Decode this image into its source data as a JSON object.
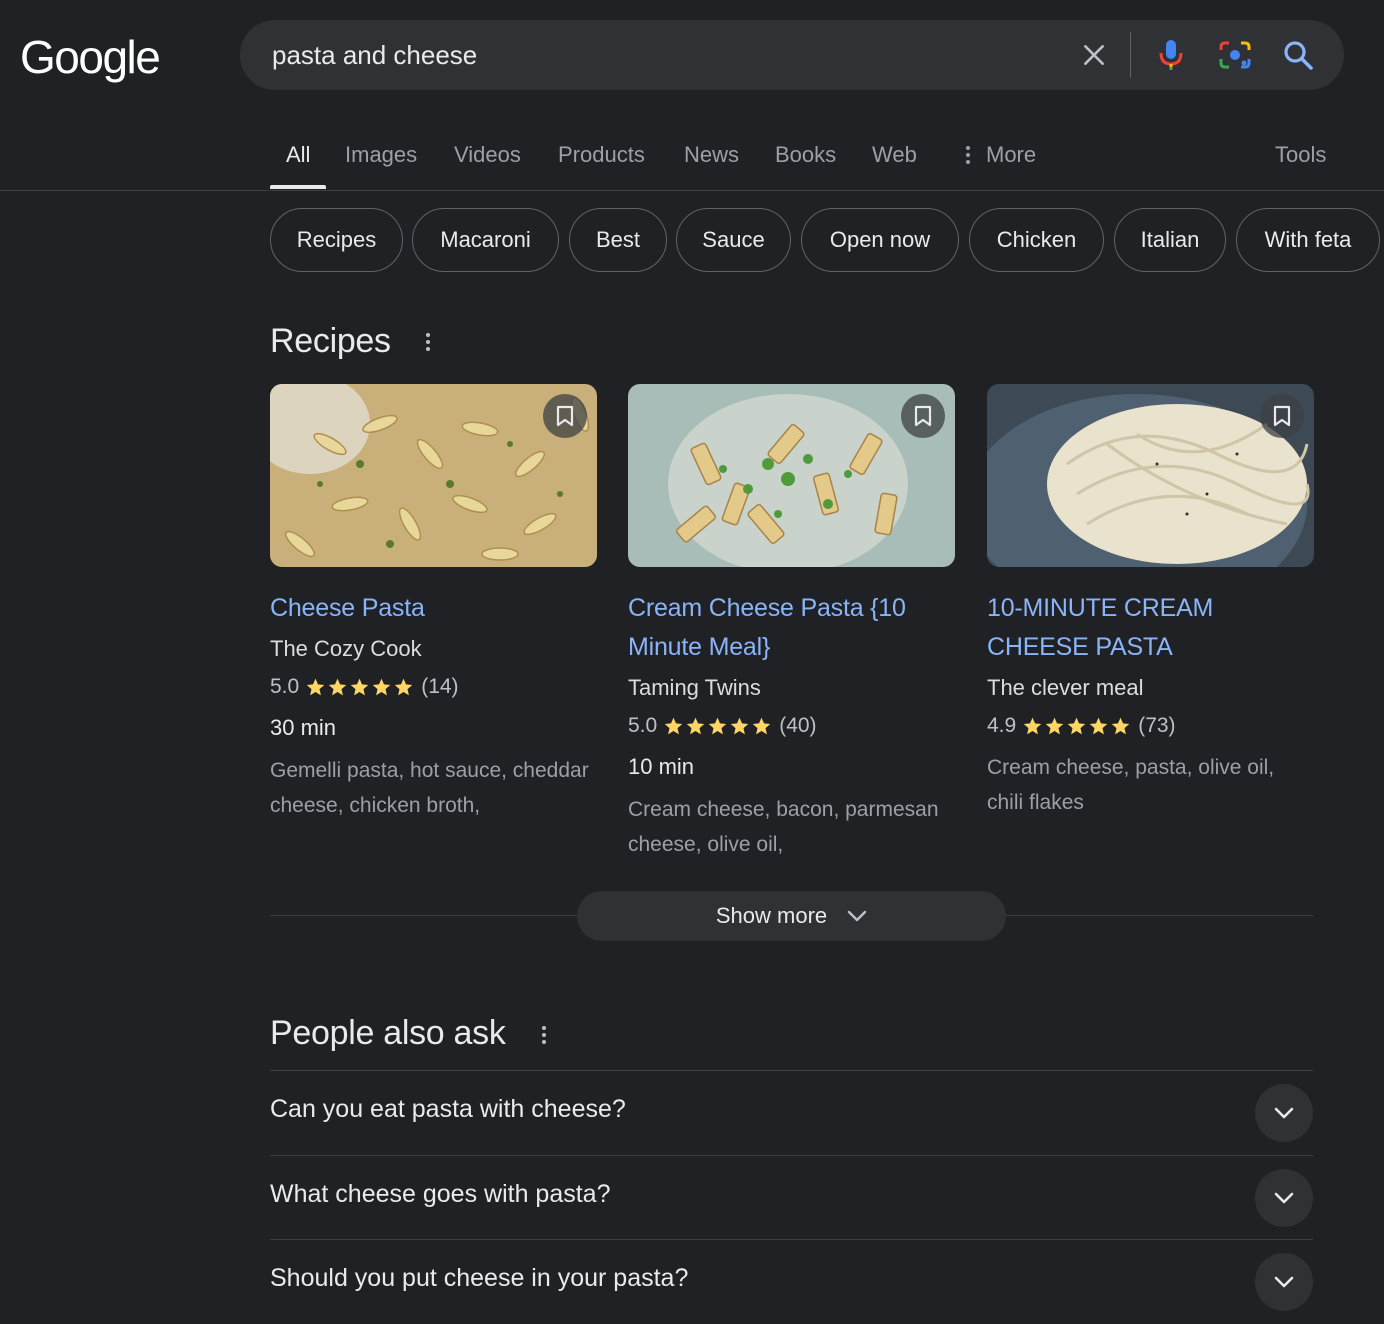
{
  "header": {
    "logo_text": "Google",
    "search_value": "pasta and cheese"
  },
  "tabs": [
    {
      "label": "All",
      "active": true
    },
    {
      "label": "Images"
    },
    {
      "label": "Videos"
    },
    {
      "label": "Products"
    },
    {
      "label": "News"
    },
    {
      "label": "Books"
    },
    {
      "label": "Web"
    },
    {
      "label": "More"
    },
    {
      "label": "Tools"
    }
  ],
  "chips": [
    "Recipes",
    "Macaroni",
    "Best",
    "Sauce",
    "Open now",
    "Chicken",
    "Italian",
    "With feta"
  ],
  "recipes": {
    "title": "Recipes",
    "cards": [
      {
        "title": "Cheese Pasta",
        "source": "The Cozy Cook",
        "rating": "5.0",
        "stars": 5,
        "reviews": "(14)",
        "time": "30 min",
        "ingredients": "Gemelli pasta, hot sauce, cheddar cheese, chicken broth,"
      },
      {
        "title": "Cream Cheese Pasta {10 Minute Meal}",
        "source": "Taming Twins",
        "rating": "5.0",
        "stars": 5,
        "reviews": "(40)",
        "time": "10 min",
        "ingredients": "Cream cheese, bacon, parmesan cheese, olive oil,"
      },
      {
        "title": "10-MINUTE CREAM CHEESE PASTA",
        "source": "The clever meal",
        "rating": "4.9",
        "stars": 5,
        "reviews": "(73)",
        "time": "",
        "ingredients": "Cream cheese, pasta, olive oil, chili flakes"
      }
    ],
    "show_more": "Show more"
  },
  "paa": {
    "title": "People also ask",
    "questions": [
      "Can you eat pasta with cheese?",
      "What cheese goes with pasta?",
      "Should you put cheese in your pasta?"
    ]
  },
  "colors": {
    "background": "#202124",
    "link": "#8ab4f8",
    "star": "#fdd663",
    "surface": "#303134"
  }
}
